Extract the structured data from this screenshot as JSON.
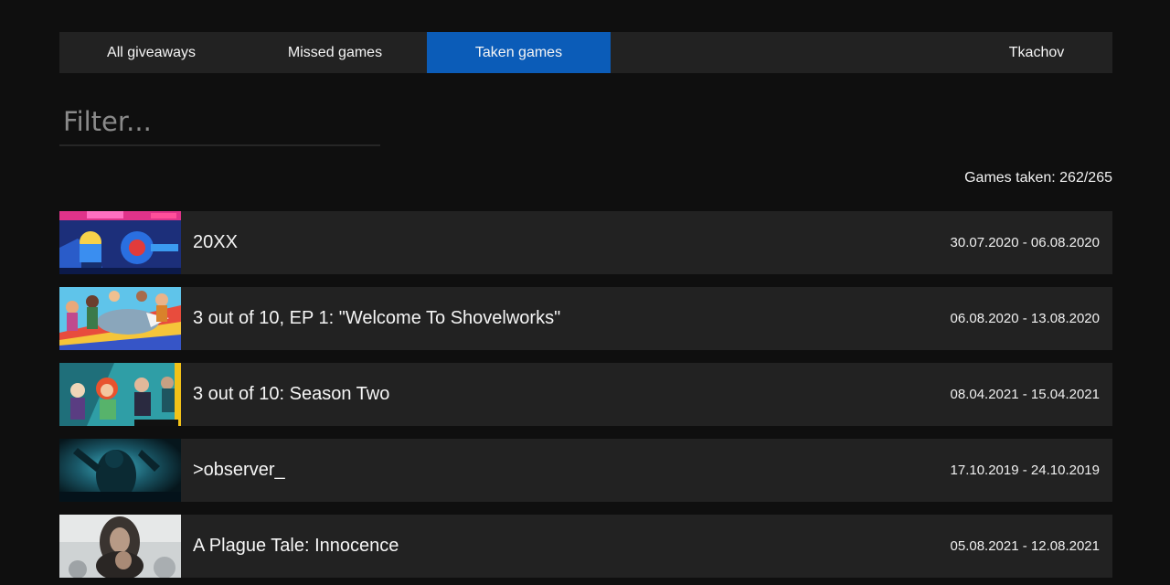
{
  "nav": {
    "tabs": [
      {
        "label": "All giveaways",
        "active": false
      },
      {
        "label": "Missed games",
        "active": false
      },
      {
        "label": "Taken games",
        "active": true
      }
    ],
    "user": "Tkachov",
    "active_color": "#0b5cb8"
  },
  "filter": {
    "placeholder": "Filter...",
    "value": ""
  },
  "summary": {
    "games_taken": "Games taken: 262/265"
  },
  "games": [
    {
      "title": "20XX",
      "dates": "30.07.2020 - 06.08.2020",
      "thumbnail": "20xx-cover-art"
    },
    {
      "title": "3 out of 10, EP 1: \"Welcome To Shovelworks\"",
      "dates": "06.08.2020 - 13.08.2020",
      "thumbnail": "3-out-of-10-ep1-cover-art"
    },
    {
      "title": "3 out of 10: Season Two",
      "dates": "08.04.2021 - 15.04.2021",
      "thumbnail": "3-out-of-10-season-two-cover-art"
    },
    {
      "title": ">observer_",
      "dates": "17.10.2019 - 24.10.2019",
      "thumbnail": "observer-cover-art"
    },
    {
      "title": "A Plague Tale: Innocence",
      "dates": "05.08.2021 - 12.08.2021",
      "thumbnail": "a-plague-tale-cover-art"
    }
  ]
}
